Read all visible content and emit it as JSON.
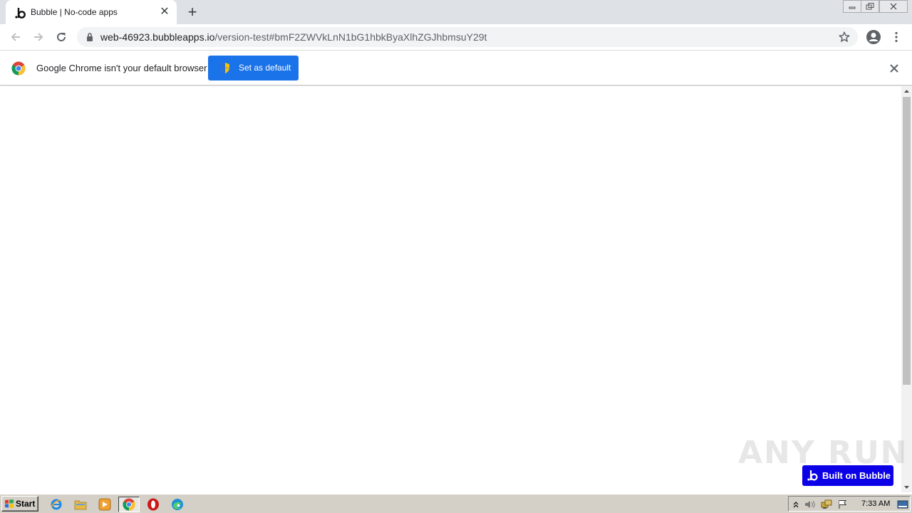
{
  "browser": {
    "tab": {
      "title": "Bubble | No-code apps",
      "favicon": "bubble-b-icon"
    },
    "new_tab": "+",
    "address": {
      "host": "web-46923.bubbleapps.io",
      "path": "/version-test#bmF2ZWVkLnN1bG1hbkByaXlhZGJhbmsuY29t"
    },
    "infobar": {
      "message": "Google Chrome isn't your default browser",
      "button_label": "Set as default"
    }
  },
  "page": {
    "watermark": "ANY RUN",
    "badge_label": "Built on Bubble"
  },
  "taskbar": {
    "start_label": "Start",
    "pinned": [
      "ie-icon",
      "explorer-folder-icon",
      "media-player-icon",
      "chrome-icon",
      "opera-icon",
      "edge-icon"
    ],
    "clock": "7:33 AM"
  },
  "colors": {
    "accent_blue": "#1a73e8",
    "bubble_blue": "#0c00e6",
    "tabstrip": "#dee1e6",
    "taskbar": "#d4d0c8"
  }
}
